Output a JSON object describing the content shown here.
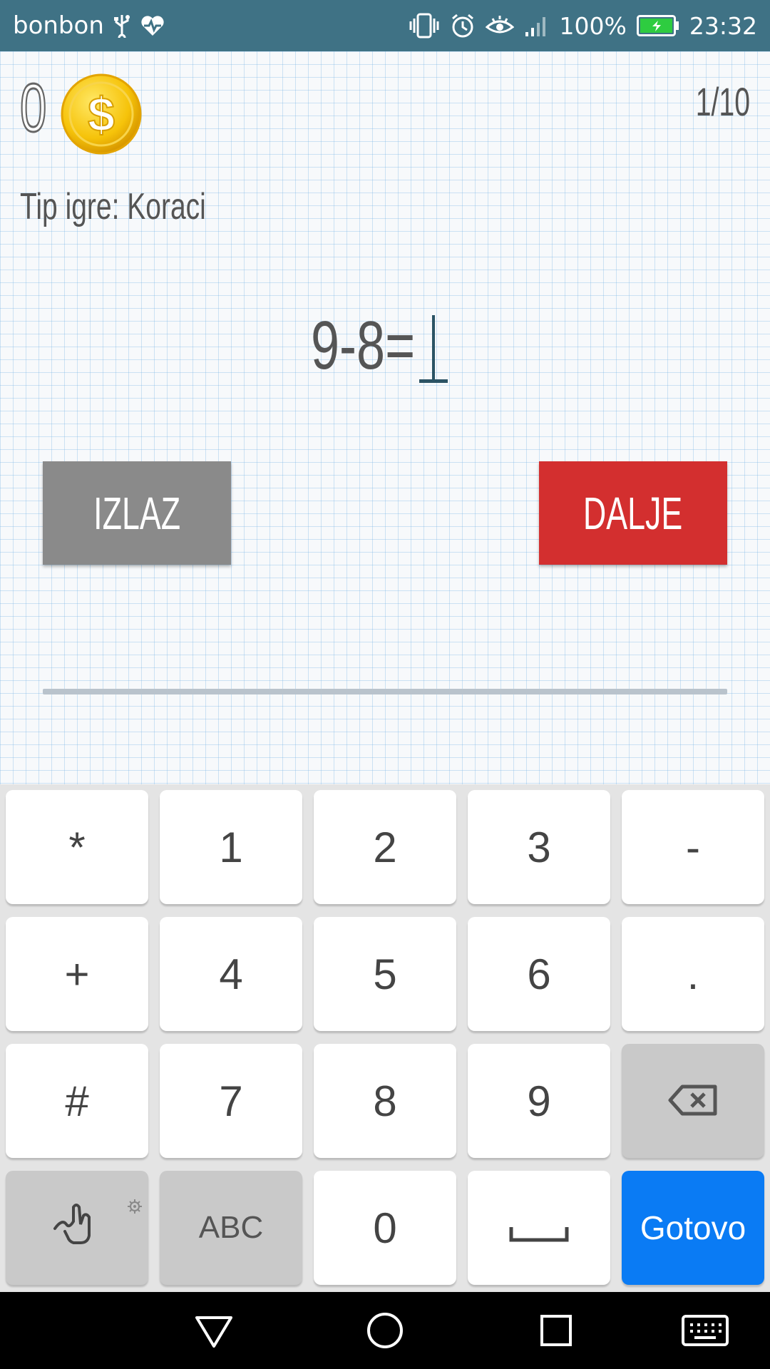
{
  "status_bar": {
    "carrier": "bonbon",
    "battery_percent": "100%",
    "time": "23:32"
  },
  "game": {
    "coins": "0",
    "progress": "1/10",
    "game_type_label": "Tip igre: Koraci",
    "equation": "9-8=",
    "answer": "",
    "exit_label": "IZLAZ",
    "next_label": "DALJE"
  },
  "keyboard": {
    "rows": [
      [
        "*",
        "1",
        "2",
        "3",
        "-"
      ],
      [
        "+",
        "4",
        "5",
        "6",
        "."
      ],
      [
        "#",
        "7",
        "8",
        "9",
        "backspace"
      ],
      [
        "gesture",
        "ABC",
        "0",
        "space",
        "Gotovo"
      ]
    ],
    "done_label": "Gotovo",
    "abc_label": "ABC"
  },
  "colors": {
    "status_bar": "#3f7285",
    "exit_button": "#8a8a8a",
    "next_button": "#d32f2f",
    "done_key": "#0a7bf4"
  }
}
